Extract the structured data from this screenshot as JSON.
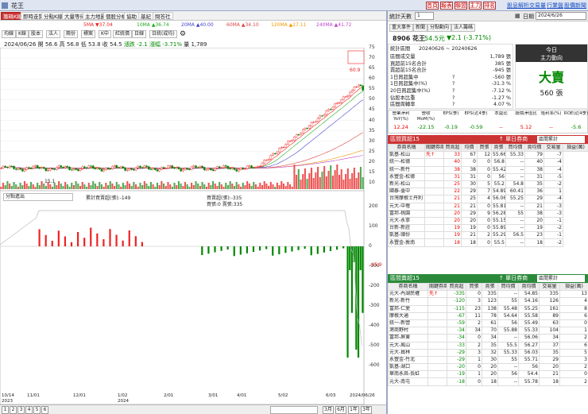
{
  "app": {
    "title": "花王"
  },
  "top_buttons": [
    "首頁",
    "報表",
    "聯盟",
    "主力",
    "排名"
  ],
  "top_links": [
    "股息解析",
    "交易量",
    "行業盤",
    "股價新聞"
  ],
  "chart_tabs": [
    "籌碼K線",
    "即時走勢",
    "分點K線",
    "大量等待",
    "主力地圖",
    "個股分析",
    "協助",
    "基紀",
    "問答社"
  ],
  "ma": [
    {
      "label": "5MA",
      "value": "▼37.04",
      "color": "#e22"
    },
    {
      "label": "10MA",
      "value": "▲36.74",
      "color": "#2a2"
    },
    {
      "label": "20MA",
      "value": "▲40.00",
      "color": "#44c"
    },
    {
      "label": "60MA",
      "value": "▲34.10",
      "color": "#d44"
    },
    {
      "label": "120MA",
      "value": "▲27.11",
      "color": "#e90"
    },
    {
      "label": "240MA",
      "value": "▲41.72",
      "color": "#b4c"
    }
  ],
  "chart_toolbar": [
    "均線",
    "K線",
    "股本",
    "法人",
    "兩份",
    "標案",
    "K中",
    "紅統價",
    "日線",
    "日統(成均)"
  ],
  "info": {
    "date": "2024/06/26",
    "open_l": "開",
    "open": "56.6",
    "high_l": "高",
    "high": "56.8",
    "low_l": "低",
    "low": "53.8",
    "close_l": "收",
    "close": "54.5",
    "change_l": "漲跌",
    "change": "-2.1",
    "pct_l": "漲幅",
    "pct": "-3.71%",
    "vol_l": "量",
    "vol": "1,789"
  },
  "annotations": {
    "high": "60.9",
    "low": "15.1"
  },
  "legend": {
    "dropdown": "分點進出",
    "cum": "累計買賣超(張):-149",
    "buy": "買賣超(張):-335",
    "buy2": "買張:0 賣張:335"
  },
  "price_axis": [
    "75",
    "70",
    "65",
    "60",
    "55",
    "50",
    "45",
    "40",
    "35",
    "30",
    "25",
    "20",
    "15",
    "10"
  ],
  "sub_axis": [
    "200",
    "100",
    "0",
    "-100",
    "-200",
    "-300",
    "-400",
    "-500",
    "-600"
  ],
  "sub_last": "-45.9",
  "x_axis": [
    "10/14",
    "11/01",
    "12/01",
    "1/02",
    "2/01",
    "3/01",
    "4/01",
    "5/02",
    "6/03",
    "2024/06/26"
  ],
  "x_years": [
    "2023",
    "2024"
  ],
  "pages": [
    "1",
    "2",
    "3",
    "4",
    "5",
    "6"
  ],
  "periods": [
    "3月",
    "6月",
    "1年",
    "3年"
  ],
  "right": {
    "label": "統計天數",
    "days": "1",
    "date_label": "日期",
    "date": "2024/6/26",
    "stock": "8906 花王",
    "price": "54.5元",
    "chg": "▼2.1 (-3.71%)"
  },
  "rtabs": [
    "重大事件",
    "新聞",
    "分點動向",
    "法人籌碼"
  ],
  "summary": {
    "label": "統計區間",
    "range": "20240626 ~ 20240626",
    "rows": [
      {
        "k": "區間成交量",
        "v": "1,789 張",
        "m": ""
      },
      {
        "k": "買超前15名合計",
        "v": "385 張",
        "m": ""
      },
      {
        "k": "賣超前15名合計",
        "v": "-945 張",
        "m": ""
      },
      {
        "k": "1日買超集中",
        "v": "-560 張",
        "m": "?"
      },
      {
        "k": "1日買超集中(%)",
        "v": "-31.3 %",
        "m": "?"
      },
      {
        "k": "20日買超集中(%)",
        "v": "-7.12 %",
        "m": "?"
      },
      {
        "k": "佔股本比重",
        "v": "-1.27 %",
        "m": "?"
      },
      {
        "k": "區間周轉率",
        "v": "4.07 %",
        "m": "?"
      }
    ]
  },
  "today": {
    "l1": "今日",
    "l2": "主力動向",
    "big": "大賣",
    "num": "560 張"
  },
  "pe": {
    "heads": [
      "營業淨利YoY(%)",
      "營收MoM(%)",
      "EPS(季)",
      "EPS(近4季)",
      "本益比",
      "股價淨值比",
      "殖利率(%)",
      "ROE(近4季)"
    ],
    "vals": [
      "12.24",
      "-22.15",
      "-0.19",
      "-0.59",
      "--",
      "5.12",
      "--",
      "-5.6"
    ]
  },
  "buy": {
    "title": "區間買超15",
    "mode": "↑ 單日券商",
    "sel": "區間累計",
    "cols": [
      "券商名稱",
      "關鍵券商",
      "買賣超",
      "均價",
      "買張",
      "賣張",
      "買均價",
      "賣均價",
      "交易量",
      "損益(萬)"
    ],
    "rows": [
      [
        "凱基-松山",
        "先↑",
        "33",
        "67",
        "12",
        "55.66",
        "55.33",
        "79",
        "-7"
      ],
      [
        "統一-松德",
        "",
        "40",
        "0",
        "0",
        "56.8",
        "--",
        "40",
        "-4"
      ],
      [
        "統一-新竹",
        "",
        "38",
        "38",
        "0",
        "55.42",
        "--",
        "38",
        "-4"
      ],
      [
        "永豐金-松德",
        "",
        "31",
        "31",
        "0",
        "56",
        "--",
        "31",
        "-5"
      ],
      [
        "新光-松山",
        "",
        "25",
        "30",
        "5",
        "55.2",
        "54.8",
        "35",
        "-2"
      ],
      [
        "國泰-臺中",
        "",
        "22",
        "29",
        "7",
        "54.89",
        "60.41",
        "36",
        "1"
      ],
      [
        "台灣摩根士丹利",
        "",
        "21",
        "25",
        "4",
        "56.06",
        "55.25",
        "29",
        "-4"
      ],
      [
        "元大-中壢",
        "",
        "21",
        "21",
        "0",
        "55.81",
        "--",
        "21",
        "-3"
      ],
      [
        "富邦-桃園",
        "",
        "20",
        "29",
        "9",
        "56.28",
        "55",
        "38",
        "-3"
      ],
      [
        "元大-永寧",
        "",
        "20",
        "20",
        "0",
        "55.15",
        "--",
        "20",
        "-1"
      ],
      [
        "台新-新莊",
        "",
        "19",
        "19",
        "0",
        "55.89",
        "--",
        "19",
        "-2"
      ],
      [
        "凱基-頭份",
        "",
        "19",
        "21",
        "2",
        "55.29",
        "56.5",
        "23",
        "-1"
      ],
      [
        "永豐金-敦南",
        "",
        "18",
        "18",
        "0",
        "55.5",
        "--",
        "18",
        "-2"
      ]
    ]
  },
  "sell": {
    "title": "區間賣超15",
    "mode": "↑ 單日券商",
    "sel": "區間累計",
    "cols": [
      "券商名稱",
      "關鍵券商",
      "買賣超",
      "買張",
      "賣張",
      "買均價",
      "賣均價",
      "交易量",
      "損益(萬)"
    ],
    "rows": [
      [
        "元大-內湖民權",
        "先↑",
        "-335",
        "0",
        "335",
        "--",
        "54.85",
        "335",
        "13"
      ],
      [
        "新光-新竹",
        "",
        "-120",
        "3",
        "123",
        "55",
        "54.16",
        "126",
        "4"
      ],
      [
        "富邦-仁愛",
        "",
        "-115",
        "23",
        "138",
        "55.48",
        "55.25",
        "161",
        "8"
      ],
      [
        "摩根大通",
        "",
        "-67",
        "11",
        "78",
        "54.64",
        "55.58",
        "89",
        "6"
      ],
      [
        "統一-新營",
        "",
        "-59",
        "2",
        "61",
        "56",
        "55.49",
        "63",
        "0"
      ],
      [
        "港商野村",
        "",
        "-34",
        "34",
        "70",
        "55.88",
        "55.33",
        "104",
        "1"
      ],
      [
        "富邦-屏東",
        "",
        "-34",
        "0",
        "34",
        "--",
        "56.06",
        "34",
        "2"
      ],
      [
        "元大-鳳山",
        "",
        "-33",
        "2",
        "35",
        "55.5",
        "56.27",
        "37",
        "6"
      ],
      [
        "元大-員林",
        "",
        "-29",
        "3",
        "32",
        "55.33",
        "56.03",
        "35",
        "5"
      ],
      [
        "永豐金-竹北",
        "",
        "-29",
        "1",
        "30",
        "55",
        "55.71",
        "29",
        "3"
      ],
      [
        "凱基-湖口",
        "",
        "-20",
        "0",
        "20",
        "--",
        "56",
        "20",
        "2"
      ],
      [
        "華南永昌-長虹",
        "",
        "-19",
        "1",
        "20",
        "56",
        "54.4",
        "21",
        "0"
      ],
      [
        "元大-南屯",
        "",
        "-18",
        "0",
        "18",
        "--",
        "55.78",
        "18",
        "2"
      ]
    ]
  },
  "chart_data": {
    "type": "candlestick",
    "start": "2023/10/14",
    "end": "2024/06/26",
    "price_range": [
      10,
      75
    ],
    "high": 60.9,
    "low": 15.1,
    "last_close": 54.5,
    "sub_range": [
      -600,
      200
    ],
    "sub_last": -45.9
  }
}
